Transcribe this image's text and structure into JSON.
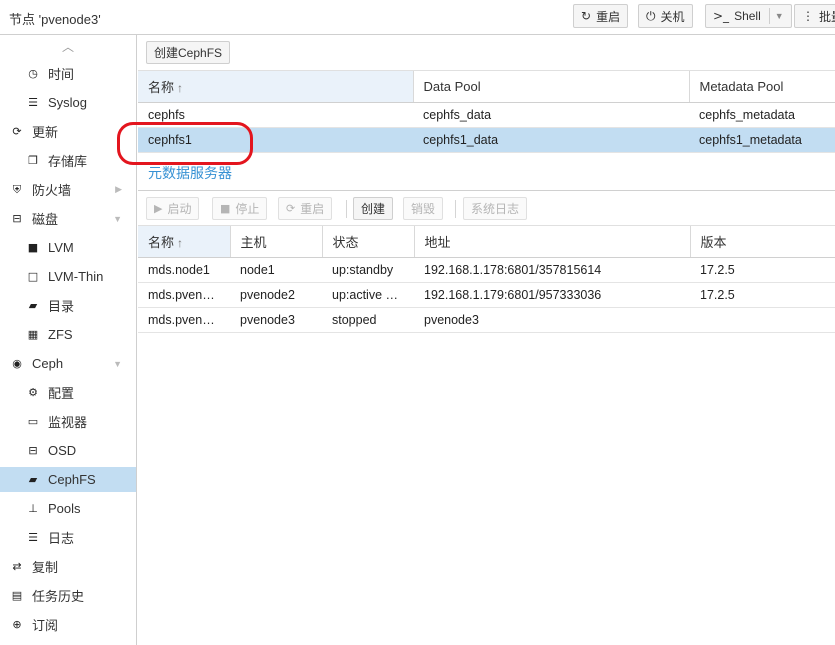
{
  "header": {
    "title": "节点 'pvenode3'",
    "buttons": [
      {
        "icon": "↻",
        "label": "重启"
      },
      {
        "icon": "⏻",
        "label": "关机"
      },
      {
        "icon": ">_",
        "label": "Shell"
      },
      {
        "icon": "⋮",
        "label": "批量"
      }
    ]
  },
  "sidebar": {
    "items": [
      {
        "label": "时间",
        "icon": "clock-icon",
        "glyph": "◷"
      },
      {
        "label": "Syslog",
        "icon": "list-icon",
        "glyph": "☰"
      },
      {
        "label": "更新",
        "icon": "refresh-icon",
        "glyph": "⟳"
      },
      {
        "label": "存储库",
        "icon": "copy-icon",
        "glyph": "❐"
      },
      {
        "label": "防火墙",
        "icon": "shield-icon",
        "glyph": "⛨"
      },
      {
        "label": "磁盘",
        "icon": "hdd-icon",
        "glyph": "⊟"
      },
      {
        "label": "LVM",
        "icon": "square-icon",
        "glyph": "■"
      },
      {
        "label": "LVM-Thin",
        "icon": "square-outline-icon",
        "glyph": "□"
      },
      {
        "label": "目录",
        "icon": "folder-icon",
        "glyph": "▰"
      },
      {
        "label": "ZFS",
        "icon": "grid-icon",
        "glyph": "▦"
      },
      {
        "label": "Ceph",
        "icon": "ceph-icon",
        "glyph": "◉"
      },
      {
        "label": "配置",
        "icon": "gear-icon",
        "glyph": "⚙"
      },
      {
        "label": "监视器",
        "icon": "monitor-icon",
        "glyph": "▭"
      },
      {
        "label": "OSD",
        "icon": "hdd-icon",
        "glyph": "⊟"
      },
      {
        "label": "CephFS",
        "icon": "folder-icon",
        "glyph": "▰"
      },
      {
        "label": "Pools",
        "icon": "sitemap-icon",
        "glyph": "⊥"
      },
      {
        "label": "日志",
        "icon": "list-icon",
        "glyph": "☰"
      },
      {
        "label": "复制",
        "icon": "retweet-icon",
        "glyph": "⇄"
      },
      {
        "label": "任务历史",
        "icon": "list-alt-icon",
        "glyph": "▤"
      },
      {
        "label": "订阅",
        "icon": "support-icon",
        "glyph": "⊕"
      }
    ]
  },
  "cephfs": {
    "create_button": "创建CephFS",
    "columns": [
      "名称",
      "Data Pool",
      "Metadata Pool"
    ],
    "rows": [
      {
        "name": "cephfs",
        "data_pool": "cephfs_data",
        "metadata_pool": "cephfs_metadata"
      },
      {
        "name": "cephfs1",
        "data_pool": "cephfs1_data",
        "metadata_pool": "cephfs1_metadata"
      }
    ],
    "selected_row": 1
  },
  "mds": {
    "group_title": "元数据服务器",
    "buttons": {
      "start": "启动",
      "stop": "停止",
      "restart": "重启",
      "create": "创建",
      "destroy": "销毁",
      "syslog": "系统日志"
    },
    "columns": [
      "名称",
      "主机",
      "状态",
      "地址",
      "版本"
    ],
    "rows": [
      {
        "name": "mds.node1",
        "host": "node1",
        "status": "up:standby",
        "address": "192.168.1.178:6801/357815614",
        "version": "17.2.5"
      },
      {
        "name": "mds.pven…",
        "host": "pvenode2",
        "status": "up:active …",
        "address": "192.168.1.179:6801/957333036",
        "version": "17.2.5"
      },
      {
        "name": "mds.pven…",
        "host": "pvenode3",
        "status": "stopped",
        "address": "pvenode3",
        "version": ""
      }
    ]
  },
  "colors": {
    "accent": "#3892d4",
    "selection": "#c2ddf2",
    "annotation": "#e3151e"
  }
}
